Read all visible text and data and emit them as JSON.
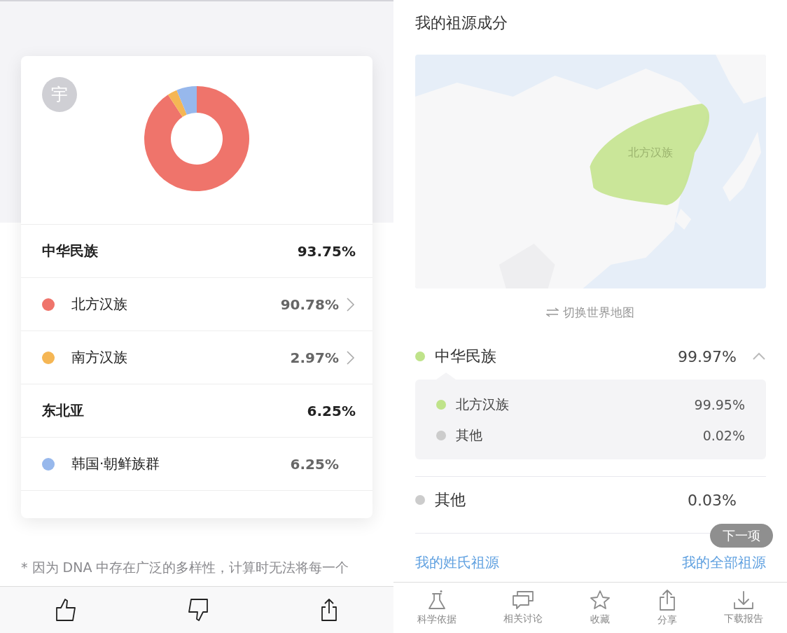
{
  "left": {
    "avatar": "宇",
    "chart_data": {
      "type": "donut",
      "values": [
        90.78,
        2.97,
        6.25
      ]
    },
    "rows": [
      {
        "kind": "group",
        "label": "中华民族",
        "value": "93.75%"
      },
      {
        "kind": "item",
        "label": "北方汉族",
        "value": "90.78%",
        "color": "#ef746b",
        "chevron": true
      },
      {
        "kind": "item",
        "label": "南方汉族",
        "value": "2.97%",
        "color": "#f5b654",
        "chevron": true
      },
      {
        "kind": "group",
        "label": "东北亚",
        "value": "6.25%"
      },
      {
        "kind": "item",
        "label": "韩国·朝鲜族群",
        "value": "6.25%",
        "color": "#97b8ec",
        "chevron": false
      }
    ],
    "footnote": "* 因为 DNA 中存在广泛的多样性，计算时无法将每一个"
  },
  "right": {
    "title": "我的祖源成分",
    "map_label": "北方汉族",
    "switch_link": "切换世界地图",
    "groups": [
      {
        "label": "中华民族",
        "value": "99.97%",
        "color": "#bfe38a",
        "expanded": true,
        "children": [
          {
            "label": "北方汉族",
            "value": "99.95%",
            "color": "#bfe38a"
          },
          {
            "label": "其他",
            "value": "0.02%",
            "color": "#cccccc"
          }
        ]
      },
      {
        "label": "其他",
        "value": "0.03%",
        "color": "#cccccc"
      }
    ],
    "links": [
      "我的姓氏祖源",
      "我的全部祖源"
    ],
    "next_button": "下一项",
    "tabs": [
      {
        "kind": "flask",
        "label": "科学依据"
      },
      {
        "kind": "chat",
        "label": "相关讨论"
      },
      {
        "kind": "star",
        "label": "收藏"
      },
      {
        "kind": "share",
        "label": "分享"
      },
      {
        "kind": "download",
        "label": "下载报告"
      }
    ]
  }
}
